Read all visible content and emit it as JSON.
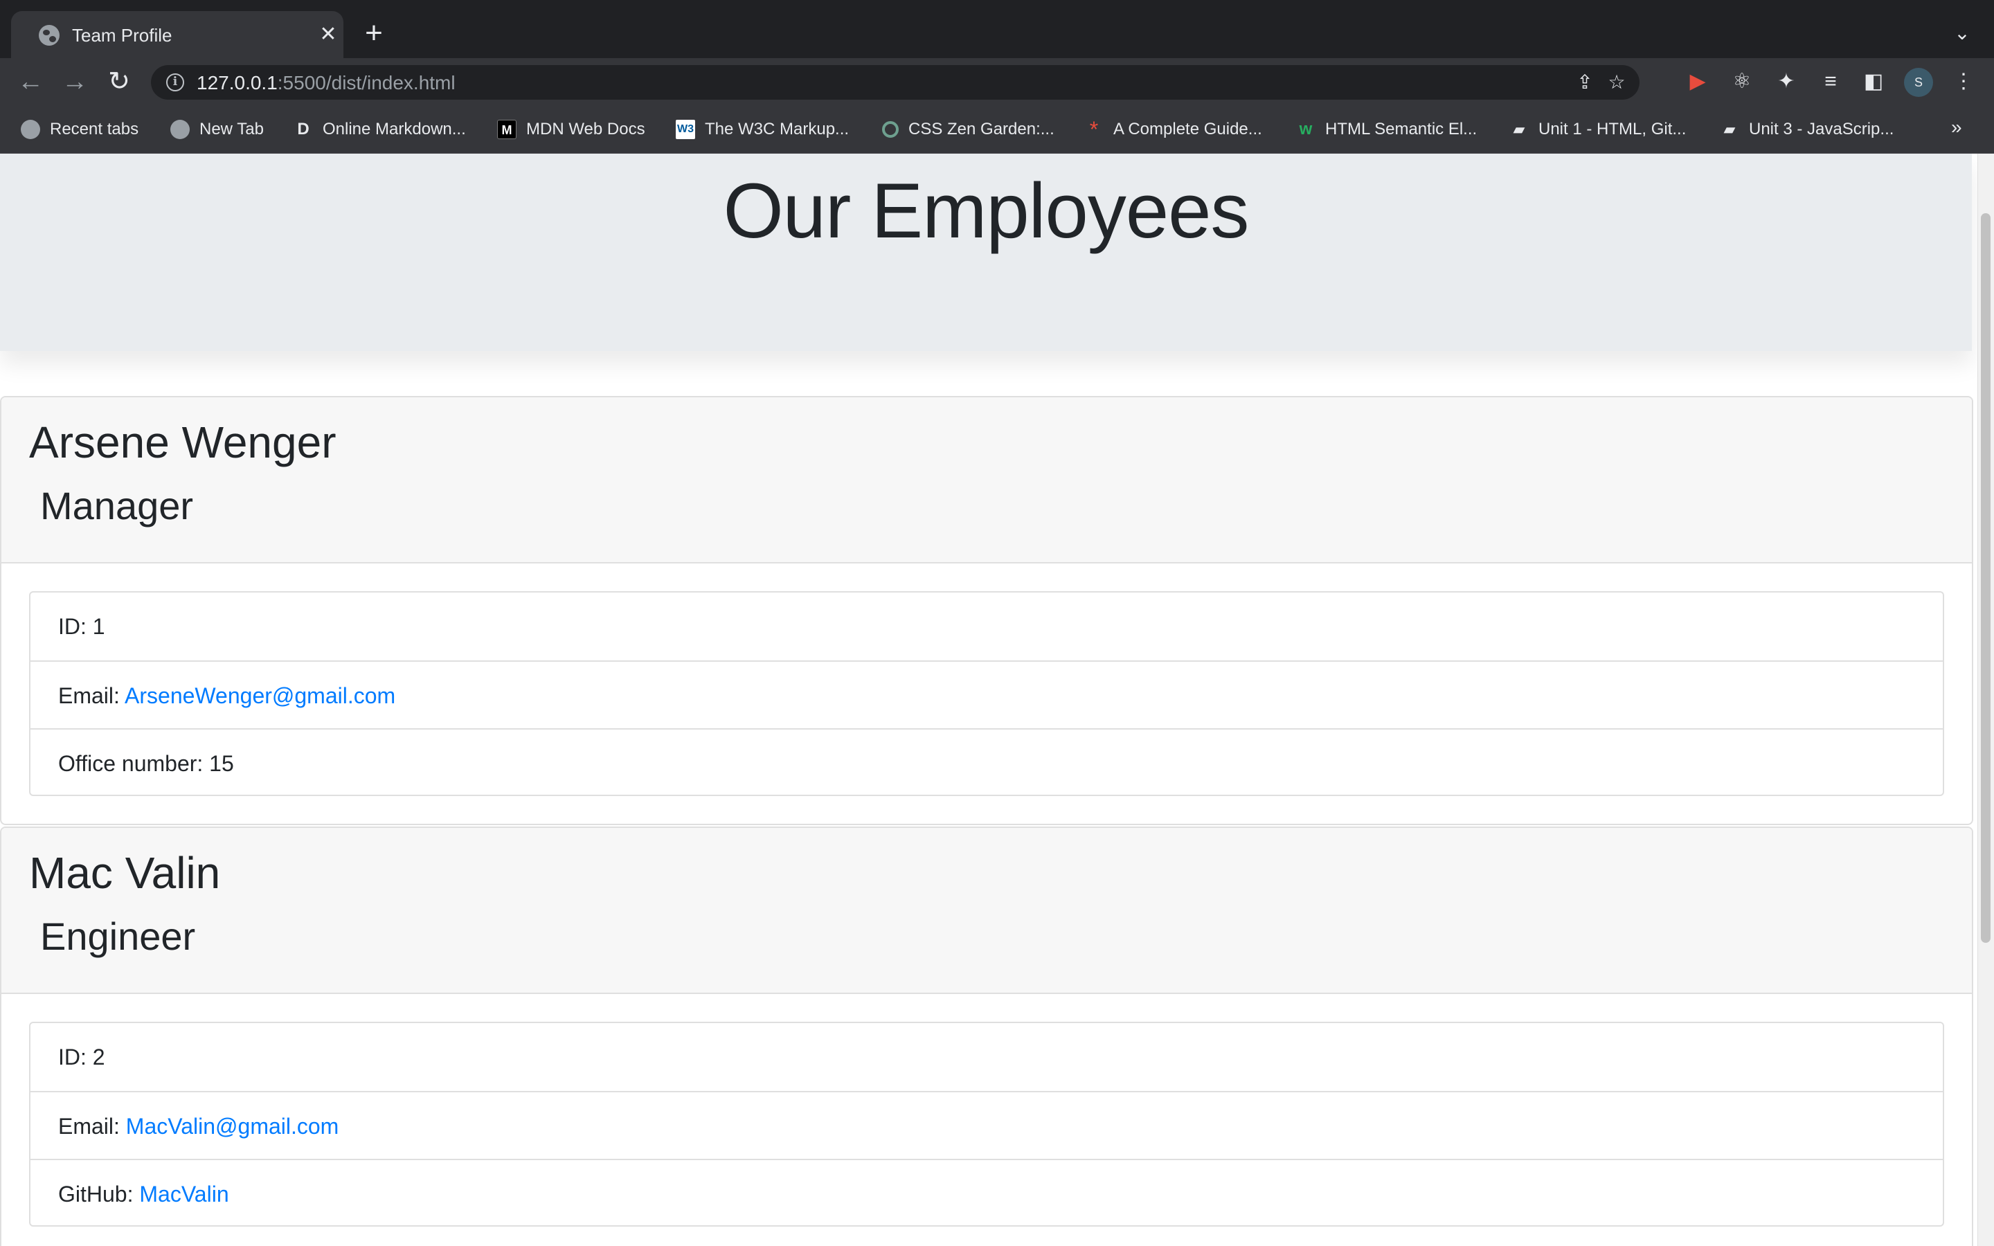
{
  "browser": {
    "tab_title": "Team Profile",
    "url_host": "127.0.0.1",
    "url_rest": ":5500/dist/index.html",
    "avatar_initial": "S",
    "bookmarks": [
      {
        "label": "Recent tabs",
        "icon": "globe-icon"
      },
      {
        "label": "New Tab",
        "icon": "globe-icon"
      },
      {
        "label": "Online Markdown...",
        "icon": "letter-d-icon"
      },
      {
        "label": "MDN Web Docs",
        "icon": "mdn-icon"
      },
      {
        "label": "The W3C Markup...",
        "icon": "w3c-icon"
      },
      {
        "label": "CSS Zen Garden:...",
        "icon": "zen-garden-icon"
      },
      {
        "label": "A Complete Guide...",
        "icon": "asterisk-icon"
      },
      {
        "label": "HTML Semantic El...",
        "icon": "w-icon"
      },
      {
        "label": "Unit 1 - HTML, Git...",
        "icon": "book-icon"
      },
      {
        "label": "Unit 3 - JavaScrip...",
        "icon": "book-icon"
      }
    ]
  },
  "page": {
    "heading": "Our Employees",
    "employees": [
      {
        "name": "Arsene Wenger",
        "role": "Manager",
        "id_label": "ID: 1",
        "email_prefix": "Email: ",
        "email": "ArseneWenger@gmail.com",
        "extra_label": "Office number: 15"
      },
      {
        "name": "Mac Valin",
        "role": "Engineer",
        "id_label": "ID: 2",
        "email_prefix": "Email: ",
        "email": "MacValin@gmail.com",
        "extra_prefix": "GitHub: ",
        "extra_link": "MacValin"
      }
    ]
  },
  "colors": {
    "link": "#007bff",
    "jumbotron_bg": "#e9ecef",
    "chrome_dark": "#202124",
    "chrome_toolbar": "#35363a"
  }
}
